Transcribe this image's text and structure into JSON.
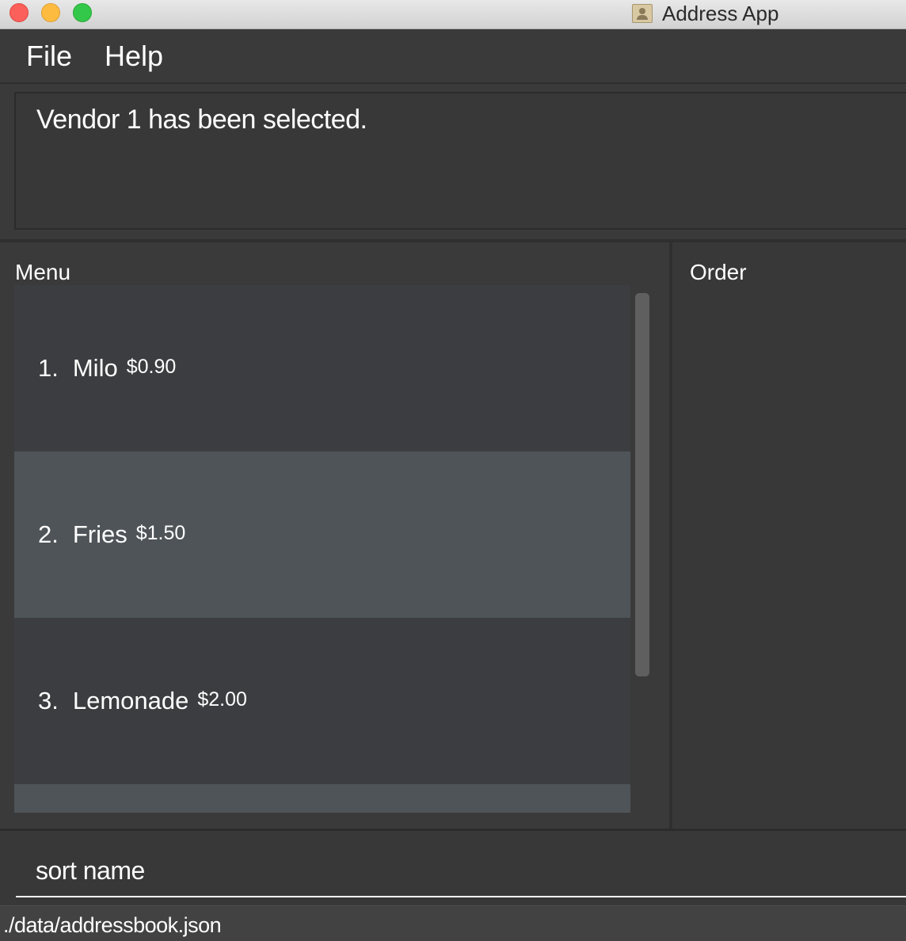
{
  "window": {
    "title": "Address App",
    "controls": [
      "close",
      "minimize",
      "maximize"
    ],
    "app_icon": "address-book-icon"
  },
  "menubar": {
    "items": [
      {
        "label": "File"
      },
      {
        "label": "Help"
      }
    ]
  },
  "result_display": {
    "text": "Vendor 1 has been selected."
  },
  "menu_panel": {
    "label": "Menu",
    "items": [
      {
        "index": "1.",
        "name": "Milo",
        "price": "$0.90"
      },
      {
        "index": "2.",
        "name": "Fries",
        "price": "$1.50"
      },
      {
        "index": "3.",
        "name": "Lemonade",
        "price": "$2.00"
      }
    ]
  },
  "order_panel": {
    "label": "Order"
  },
  "command_box": {
    "value": "sort name"
  },
  "status_bar": {
    "path": "./data/addressbook.json"
  },
  "colors": {
    "background": "#383838",
    "list_item_alt": "#4e5457",
    "list_item": "#3c3d40",
    "text": "#ffffff"
  }
}
